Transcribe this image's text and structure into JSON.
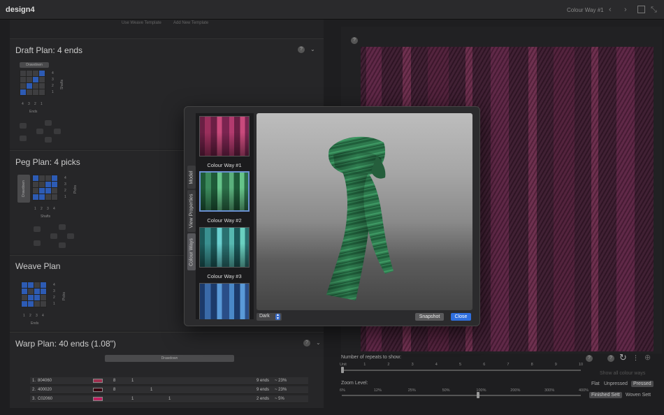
{
  "app": {
    "title": "design4",
    "window_title": "Colour Way #1"
  },
  "templates": {
    "use_label": "Use Weave Template",
    "add_label": "Add New Template"
  },
  "draft_plan": {
    "title": "Draft Plan:  4 ends",
    "treadling_label": "Drawdown",
    "axis_ends": "Ends",
    "axis_shafts": "Shafts",
    "row_labels": [
      "4",
      "3",
      "2",
      "1"
    ],
    "col_labels": [
      "4",
      "3",
      "2",
      "1"
    ]
  },
  "peg_plan": {
    "title": "Peg Plan:  4 picks",
    "side_label": "Drawdown",
    "axis_picks": "Picks",
    "axis_shafts": "Shafts",
    "row_labels": [
      "4",
      "3",
      "2",
      "1"
    ],
    "col_labels": [
      "1",
      "2",
      "3",
      "4"
    ]
  },
  "weave_plan": {
    "title": "Weave Plan",
    "axis_picks": "Picks",
    "axis_ends": "Ends",
    "row_labels": [
      "4",
      "3",
      "2",
      "1"
    ],
    "col_labels": [
      "1",
      "2",
      "3",
      "4"
    ]
  },
  "warp_plan": {
    "title": "Warp Plan:  40 ends (1.08\")",
    "bar_label": "Drawdown",
    "rows": [
      {
        "id": "1.",
        "code": "804060",
        "c1": "8",
        "c2": "1",
        "ends": "9 ends",
        "pct": "~ 23%"
      },
      {
        "id": "2.",
        "code": "400020",
        "c1": "8",
        "c2": "1",
        "ends": "9 ends",
        "pct": "~ 23%"
      },
      {
        "id": "3.",
        "code": "C02060",
        "c1": "1",
        "c2": "1",
        "ends": "2 ends",
        "pct": "~ 5%"
      }
    ]
  },
  "repeats": {
    "label": "Number of repeats to show:",
    "ticks": [
      "Unit",
      "1",
      "2",
      "3",
      "4",
      "5",
      "6",
      "7",
      "8",
      "9",
      "10"
    ],
    "value": "Unit",
    "show_all": "Show all colour ways"
  },
  "zoom": {
    "label": "Zoom Level:",
    "ticks": [
      "6%",
      "12%",
      "25%",
      "50%",
      "100%",
      "200%",
      "300%",
      "400%"
    ],
    "value": "100%"
  },
  "view_modes": {
    "options": [
      "Flat",
      "Unpressed",
      "Pressed"
    ],
    "selected": "Pressed"
  },
  "sett_modes": {
    "options": [
      "Finished Sett",
      "Woven Sett"
    ],
    "selected": "Finished Sett"
  },
  "dialog": {
    "tabs": [
      "Model",
      "View Properties",
      "Colour Ways"
    ],
    "selected_tab": "Colour Ways",
    "colour_ways": [
      {
        "label": "Colour Way #1"
      },
      {
        "label": "Colour Way #2"
      },
      {
        "label": "Colour Way #3"
      },
      {
        "label": ""
      }
    ],
    "selected_colour_way": "Colour Way #2",
    "background": "Dark",
    "snapshot_label": "Snapshot",
    "close_label": "Close"
  },
  "colors": {
    "fabric_base": "#3a1a2c",
    "fabric_stripe": "#5a2040",
    "scarf_green": "#2e7a4e",
    "accent_blue": "#2f6fdf"
  }
}
